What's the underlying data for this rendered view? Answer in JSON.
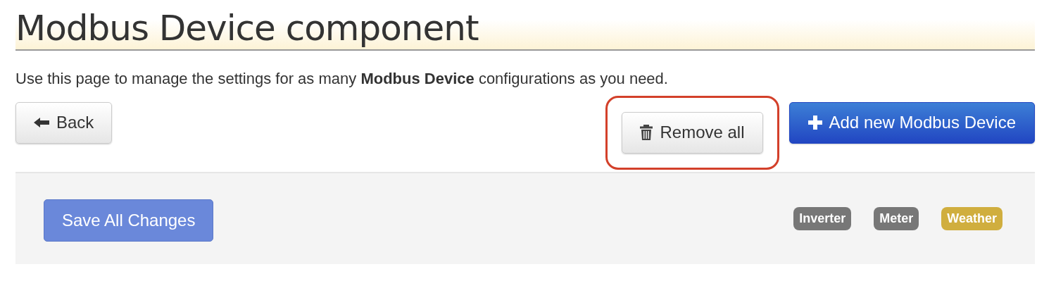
{
  "title": "Modbus Device component",
  "description": "Use this page to manage the settings for as many **Modbus Device** configurations as you need.",
  "buttons": {
    "back": "Back",
    "remove_all": "Remove all",
    "add_new": "Add new Modbus Device"
  },
  "highlight": {
    "remove_all": true
  },
  "panel": {
    "save_button": "Save All Changes",
    "tags": [
      {
        "label": "Inverter",
        "color": "#777777"
      },
      {
        "label": "Meter",
        "color": "#777777"
      },
      {
        "label": "Weather",
        "color": "#d0ae3e"
      }
    ]
  }
}
